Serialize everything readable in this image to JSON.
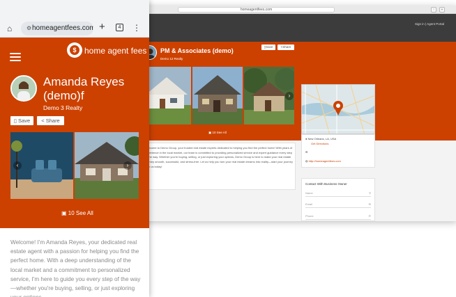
{
  "desktop": {
    "url": "homeagentfees.com",
    "header": {
      "signin": "Sign in | Agent Portal"
    },
    "profile": {
      "name": "PM & Associates (demo)",
      "realty": "Demo 12 Realty",
      "save_label": "Save",
      "share_label": "Share"
    },
    "gallery": {
      "see_all": "10 See All"
    },
    "description": "Welcome to Demo Group, your trusted real estate experts dedicated to helping you find the perfect home! With years of experience in the local market, our team is committed to providing personalized service and expert guidance every step of the way. Whether you're buying, selling, or just exploring your options, Demo Group is here to make your real estate journey smooth, successful, and stress-free. Let us help you turn your real estate dreams into reality—start your journey with us today!",
    "info": {
      "location": "New Orleans, LA, USA",
      "directions": "Get Directions",
      "website": "http://homeagentfees.com"
    },
    "contact": {
      "title": "Contact With Business Owner",
      "name_placeholder": "Name",
      "email_placeholder": "Email",
      "phone_placeholder": "Phone"
    }
  },
  "mobile": {
    "url": "homeagentfees.com/list",
    "tab_count": "4",
    "brand": "home agent fees",
    "profile": {
      "name": "Amanda Reyes (demo)f",
      "realty": "Demo 3 Realty",
      "save_label": "Save",
      "share_label": "Share"
    },
    "gallery": {
      "see_all": "10 See All"
    },
    "description": "Welcome! I'm Amanda Reyes, your dedicated real estate agent with a passion for helping you find the perfect home. With a deep understanding of the local market and a commitment to personalized service, I'm here to guide you every step of the way—whether you're buying, selling, or just exploring your options."
  },
  "colors": {
    "brand_orange": "#cc4100",
    "header_dark": "#3c3c3c"
  }
}
